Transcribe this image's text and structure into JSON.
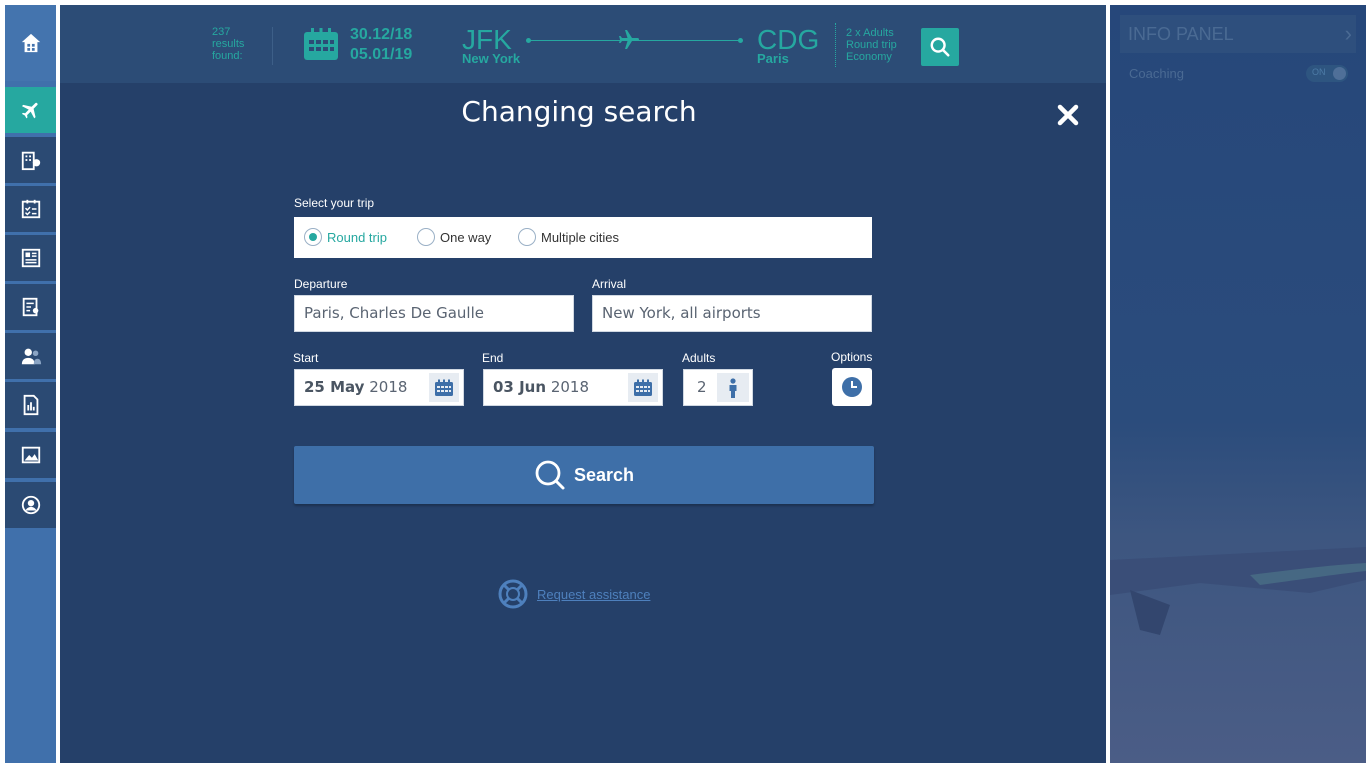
{
  "topbar": {
    "results_count": "237",
    "results_line2": "results",
    "results_line3": "found:",
    "date_out": "30.12/18",
    "date_back": "05.01/19",
    "origin_code": "JFK",
    "origin_city": "New York",
    "dest_code": "CDG",
    "dest_city": "Paris",
    "pax_line1": "2 x Adults",
    "pax_line2": "Round trip",
    "pax_line3": "Economy"
  },
  "modal": {
    "title": "Changing search",
    "trip_label": "Select your trip",
    "trip_options": [
      "Round trip",
      "One way",
      "Multiple cities"
    ],
    "selected_trip": "Round trip",
    "departure_label": "Departure",
    "departure_value": "Paris, Charles De Gaulle",
    "arrival_label": "Arrival",
    "arrival_value": "New York, all airports",
    "start_label": "Start",
    "start_day": "25 May",
    "start_year": "2018",
    "end_label": "End",
    "end_day": "03 Jun",
    "end_year": "2018",
    "adults_label": "Adults",
    "adults_value": "2",
    "options_label": "Options",
    "search_label": "Search",
    "assist_label": "Request assistance"
  },
  "info_panel": {
    "title": "INFO PANEL",
    "coaching_label": "Coaching",
    "coaching_toggle": "ON"
  },
  "sidebar": {
    "items": [
      "home-icon",
      "flight-icon",
      "hotel-icon",
      "checklist-icon",
      "document-icon",
      "report-icon",
      "users-icon",
      "stats-icon",
      "picture-icon",
      "profile-icon"
    ]
  },
  "colors": {
    "accent": "#26a8a0",
    "main_bg": "#254069",
    "sidebar_bg": "#4070ab",
    "button_blue": "#3e6fa8"
  }
}
